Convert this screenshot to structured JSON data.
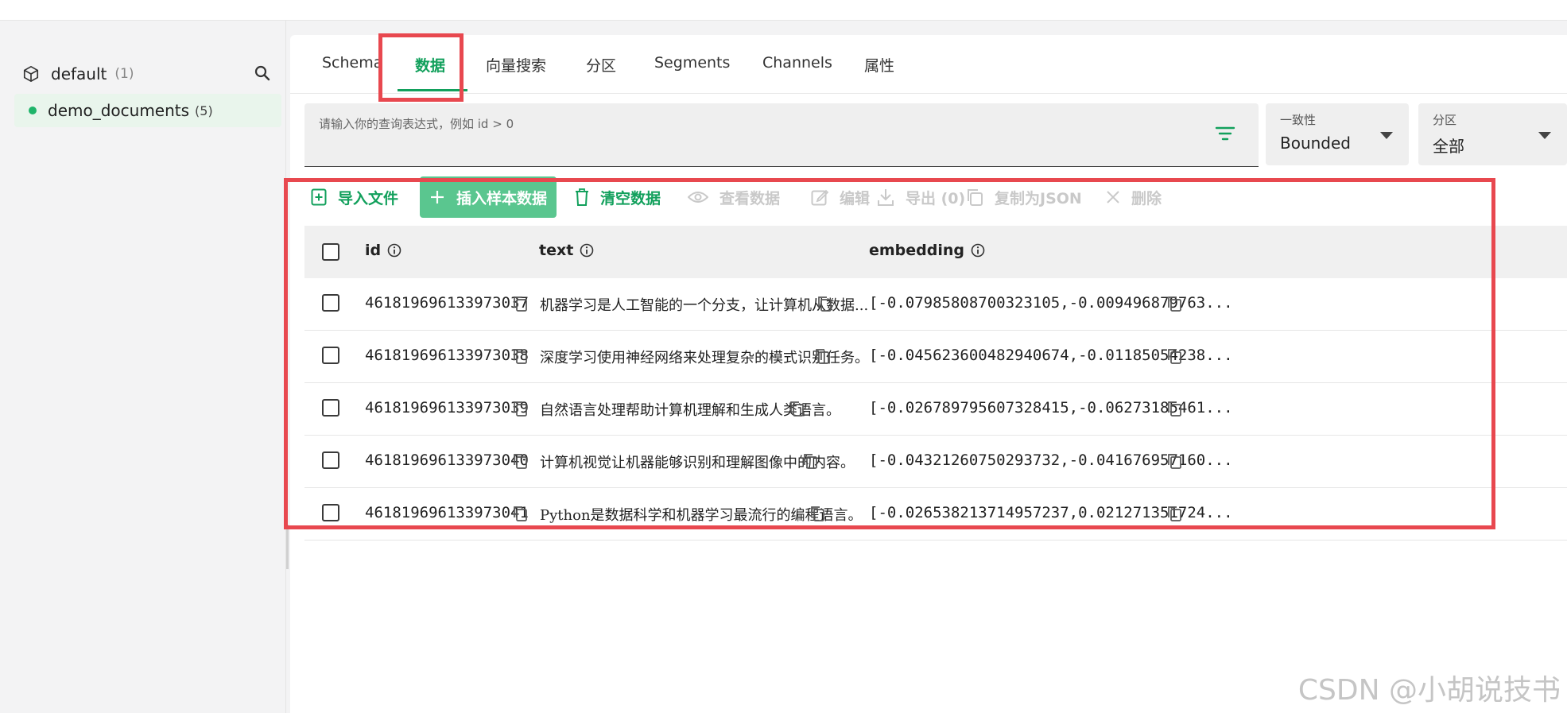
{
  "sidebar": {
    "database": {
      "name": "default",
      "count": "(1)"
    },
    "collection": {
      "name": "demo_documents",
      "count": "(5)"
    }
  },
  "tabs": [
    {
      "label": "Schema"
    },
    {
      "label": "数据",
      "active": true
    },
    {
      "label": "向量搜索"
    },
    {
      "label": "分区"
    },
    {
      "label": "Segments"
    },
    {
      "label": "Channels"
    },
    {
      "label": "属性"
    }
  ],
  "query": {
    "placeholder": "请输入你的查询表达式，例如 id > 0"
  },
  "consistency": {
    "label": "一致性",
    "value": "Bounded"
  },
  "partition": {
    "label": "分区",
    "value": "全部"
  },
  "toolbar": {
    "import_file": "导入文件",
    "insert_sample": "插入样本数据",
    "clear_data": "清空数据",
    "view_data": "查看数据",
    "edit": "编辑",
    "export": "导出 (0)",
    "copy_json": "复制为JSON",
    "delete": "删除"
  },
  "table": {
    "columns": [
      "id",
      "text",
      "embedding"
    ],
    "rows": [
      {
        "id": "461819696133973037",
        "text": "机器学习是人工智能的一个分支，让计算机从数据...",
        "embedding": "[-0.07985808700323105,-0.009496879763..."
      },
      {
        "id": "461819696133973038",
        "text": "深度学习使用神经网络来处理复杂的模式识别任务。",
        "embedding": "[-0.045623600482940674,-0.01185054238..."
      },
      {
        "id": "461819696133973039",
        "text": "自然语言处理帮助计算机理解和生成人类语言。",
        "embedding": "[-0.026789795607328415,-0.06273185461..."
      },
      {
        "id": "461819696133973040",
        "text": "计算机视觉让机器能够识别和理解图像中的内容。",
        "embedding": "[-0.04321260750293732,-0.041676957160..."
      },
      {
        "id": "461819696133973041",
        "text": "Python是数据科学和机器学习最流行的编程语言。",
        "embedding": "[-0.026538213714957237,0.021271351724..."
      }
    ]
  },
  "watermark": "CSDN @小胡说技书",
  "colors": {
    "accent": "#12a05c",
    "annotation": "#e8484f"
  }
}
